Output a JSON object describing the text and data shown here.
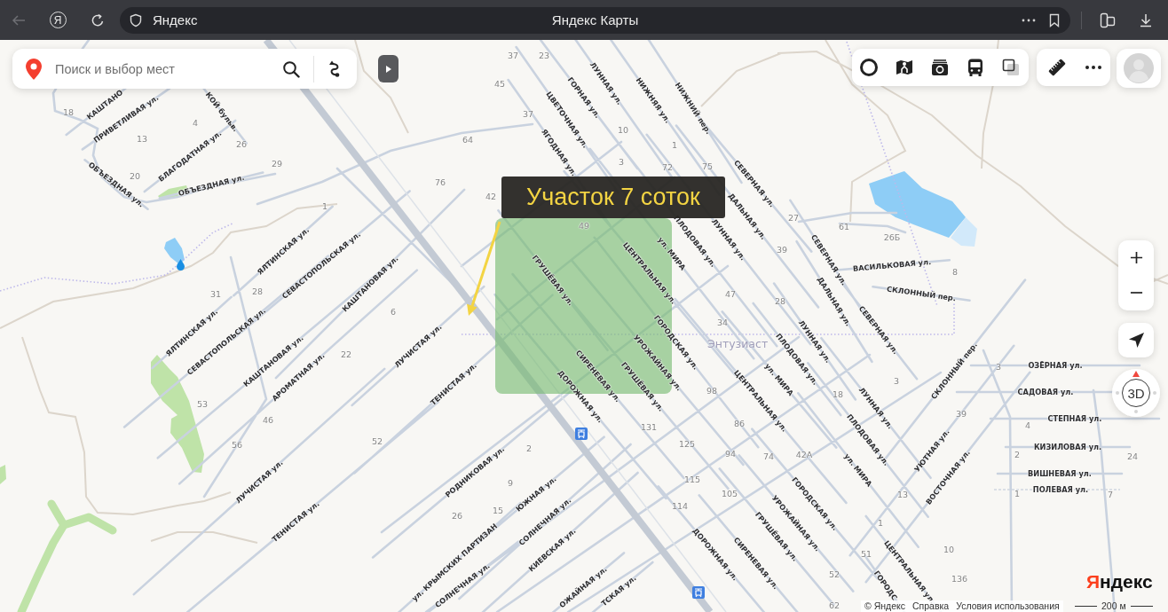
{
  "browser": {
    "back": {
      "disabled": true
    },
    "yandex_button": "Я",
    "address": "Яндекс",
    "title": "Яндекс Карты"
  },
  "search": {
    "placeholder": "Поиск и выбор мест"
  },
  "map": {
    "callout": "Участок 7 соток",
    "place_label": "Энтузиаст",
    "streets": [
      "КАШТАНО",
      "КОЙ бульв.",
      "ПРИВЕТЛИВАЯ ул.",
      "БЛАГОДАТНАЯ ул.",
      "ОБЪЕЗДНАЯ ул.",
      "ОБЪЕЗДНАЯ ул.",
      "ЯЛТИНСКАЯ ул.",
      "СЕВАСТОПОЛЬСКАЯ ул.",
      "КАШТАНОВАЯ ул.",
      "ЯЛТИНСКАЯ ул.",
      "СЕВАСТОПОЛЬСКАЯ ул.",
      "КАШТАНОВАЯ ул.",
      "АРОМАТНАЯ ул.",
      "ЛУЧИСТАЯ ул.",
      "ТЕНИСТАЯ ул.",
      "ЛУЧИСТАЯ ул.",
      "ТЕНИСТАЯ ул.",
      "РОДНИКОВАЯ ул.",
      "ЮЖНАЯ ул.",
      "СОЛНЕЧНАЯ ул.",
      "КИЕВСКАЯ ул.",
      "ул. КРЫМСКИХ ПАРТИЗАН",
      "СОЛНЕЧНАЯ ул.",
      "ОЖАЙНАЯ ул.",
      "ТСКАЯ ул.",
      "ГОРНАЯ ул.",
      "ЛУННАЯ ул.",
      "НИЖНЯЯ ул.",
      "НИЖНИЙ пер.",
      "ЦВЕТОЧНАЯ ул.",
      "ЯГОДНАЯ ул.",
      "СЕВЕРНАЯ ул.",
      "ДАЛЬНАЯ ул.",
      "ЛУННАЯ ул.",
      "ПЛОДОВАЯ ул.",
      "ул. МИРА",
      "ЦЕНТРАЛЬНАЯ ул.",
      "ГРУШЁВАЯ ул.",
      "ГОРОДСКАЯ ул.",
      "УРОЖАЙНАЯ ул.",
      "СИРЕНЕВАЯ ул.",
      "ГРУШЁВАЯ ул.",
      "ДОРОЖНАЯ ул.",
      "ЦЕНТРАЛЬНАЯ ул.",
      "ул. МИРА",
      "ДОРОЖНАЯ ул.",
      "СИРЕНЕВАЯ ул.",
      "ГРУШЁВАЯ ул.",
      "УРОЖАЙНАЯ ул.",
      "ГОРОДСКАЯ ул.",
      "ул. МИРА",
      "ПЛОДОВАЯ ул.",
      "ЛУННАЯ ул.",
      "ПЛОДОВАЯ ул.",
      "ЛУННАЯ ул.",
      "ДАЛЬНАЯ ул.",
      "СЕВЕРНАЯ ул.",
      "СЕВЕРНАЯ ул.",
      "ВАСИЛЬКОВАЯ ул.",
      "СКЛОННЫЙ пер.",
      "СКЛОННЫЙ пер.",
      "УЮТНАЯ ул.",
      "ВОСТОЧНАЯ ул.",
      "ЦЕНТРАЛЬНАЯ ул.",
      "ГОРОДС",
      "ОЗЁРНАЯ ул.",
      "САДОВАЯ ул.",
      "СТЕПНАЯ ул.",
      "КИЗИЛОВАЯ ул.",
      "ВИШНЕВАЯ ул.",
      "ПОЛЕВАЯ ул."
    ],
    "house_numbers": [
      "37",
      "23",
      "45",
      "18",
      "37",
      "4",
      "10",
      "13",
      "26",
      "64",
      "1",
      "29",
      "3",
      "72",
      "75",
      "20",
      "76",
      "42",
      "1",
      "49",
      "27",
      "61",
      "26Б",
      "39",
      "8",
      "31",
      "28",
      "47",
      "28",
      "6",
      "34",
      "22",
      "3",
      "3",
      "98",
      "18",
      "53",
      "46",
      "131",
      "86",
      "39",
      "4",
      "56",
      "52",
      "2",
      "125",
      "94",
      "74",
      "42А",
      "2",
      "24",
      "9",
      "115",
      "105",
      "13",
      "1",
      "7",
      "26",
      "15",
      "114",
      "1",
      "51",
      "10",
      "52",
      "136",
      "62"
    ]
  },
  "compass": {
    "label": "3D"
  },
  "logo": {
    "first": "Я",
    "rest": "ндекс"
  },
  "footer": {
    "copyright": "© Яндекс",
    "links": [
      "Справка",
      "Условия использования"
    ],
    "scale": "200 м"
  }
}
